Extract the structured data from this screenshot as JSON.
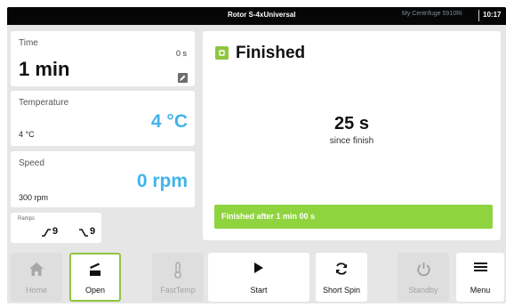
{
  "status_bar": {
    "rotor": "Rotor S-4xUniversal",
    "device": "My Centrifuge 5910Ri",
    "time": "10:17"
  },
  "time_card": {
    "label": "Time",
    "actual": "0 s",
    "setpoint": "1 min",
    "edit_icon": "edit-icon"
  },
  "temperature_card": {
    "label": "Temperature",
    "actual": "4 °C",
    "setpoint": "4 °C"
  },
  "speed_card": {
    "label": "Speed",
    "actual": "0 rpm",
    "setpoint": "300 rpm"
  },
  "ramps_card": {
    "label": "Ramps",
    "accel": "9",
    "decel": "9",
    "accel_icon": "ramp-up-icon",
    "decel_icon": "ramp-down-icon"
  },
  "status_panel": {
    "title": "Finished",
    "elapsed": "25 s",
    "elapsed_caption": "since finish",
    "message": "Finished after 1 min 00 s",
    "icon": "finished-icon",
    "accent_color": "#8ec63f"
  },
  "buttons": [
    {
      "label": "Home",
      "icon": "home-icon",
      "enabled": false
    },
    {
      "label": "Open",
      "icon": "lid-open-icon",
      "enabled": true,
      "selected": true
    },
    {
      "label": "FastTemp",
      "icon": "thermometer-icon",
      "enabled": false
    },
    {
      "label": "Start",
      "icon": "play-icon",
      "enabled": true
    },
    {
      "label": "Short Spin",
      "icon": "short-spin-icon",
      "enabled": true
    },
    {
      "label": "Standby",
      "icon": "power-icon",
      "enabled": false
    },
    {
      "label": "Menu",
      "icon": "menu-icon",
      "enabled": true
    }
  ],
  "colors": {
    "value_blue": "#42b4ec",
    "success_green": "#8fd43f"
  }
}
